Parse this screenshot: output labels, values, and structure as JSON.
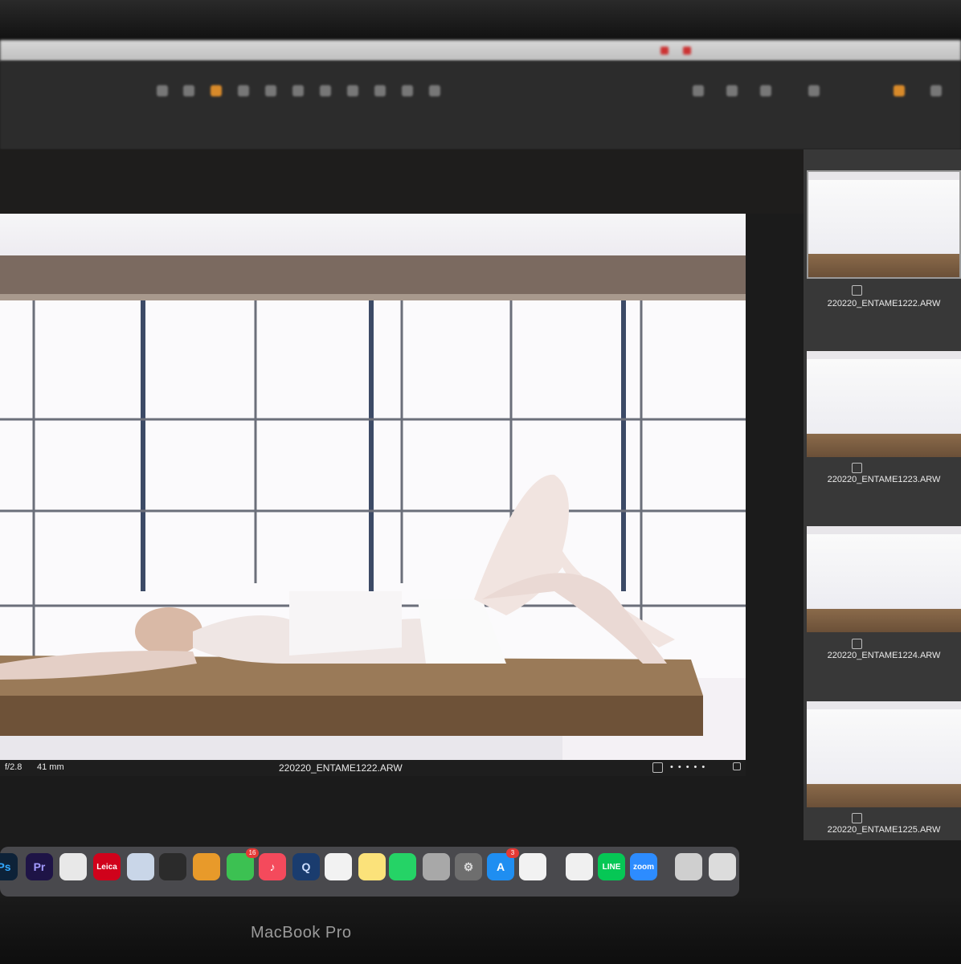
{
  "main_photo": {
    "filename": "220220_ENTAME1222.ARW",
    "aperture": "f/2.8",
    "focal_length": "41 mm"
  },
  "filmstrip": [
    {
      "filename": "220220_ENTAME1222.ARW"
    },
    {
      "filename": "220220_ENTAME1223.ARW"
    },
    {
      "filename": "220220_ENTAME1224.ARW"
    },
    {
      "filename": "220220_ENTAME1225.ARW"
    }
  ],
  "dock": {
    "apps": [
      {
        "name": "photoshop-icon",
        "label": "Ps",
        "color": "#0d2238",
        "fg": "#31a8ff"
      },
      {
        "name": "premiere-icon",
        "label": "Pr",
        "color": "#1e1446",
        "fg": "#a39bff"
      },
      {
        "name": "chrome-icon",
        "label": "",
        "color": "#e8e8e8",
        "fg": "#333"
      },
      {
        "name": "leica-icon",
        "label": "Leica",
        "color": "#d0021b",
        "fg": "#ffffff"
      },
      {
        "name": "preview-icon",
        "label": "",
        "color": "#c9d6e8",
        "fg": "#333"
      },
      {
        "name": "davinci-resolve-icon",
        "label": "",
        "color": "#2b2b2b",
        "fg": "#fff"
      },
      {
        "name": "pages-icon",
        "label": "",
        "color": "#e89a2a",
        "fg": "#fff"
      },
      {
        "name": "facetime-icon",
        "label": "",
        "color": "#3cc152",
        "fg": "#fff"
      },
      {
        "name": "music-icon",
        "label": "♪",
        "color": "#f44a5c",
        "fg": "#fff"
      },
      {
        "name": "quicktime-icon",
        "label": "Q",
        "color": "#1a3c6e",
        "fg": "#cfe0ff"
      },
      {
        "name": "script-editor-icon",
        "label": "",
        "color": "#f2f2f2",
        "fg": "#333"
      },
      {
        "name": "notes-icon",
        "label": "",
        "color": "#fbe27a",
        "fg": "#333"
      },
      {
        "name": "whatsapp-icon",
        "label": "",
        "color": "#25d366",
        "fg": "#fff"
      },
      {
        "name": "screenshot-icon",
        "label": "",
        "color": "#a8a8a8",
        "fg": "#333"
      },
      {
        "name": "system-preferences-icon",
        "label": "⚙",
        "color": "#6e6e6e",
        "fg": "#ddd"
      },
      {
        "name": "app-store-icon",
        "label": "A",
        "color": "#1f8ef1",
        "fg": "#fff"
      },
      {
        "name": "keynote-icon",
        "label": "",
        "color": "#f2f2f2",
        "fg": "#333"
      },
      {
        "name": "acrobat-icon",
        "label": "",
        "color": "#f0f0f0",
        "fg": "#e02020"
      },
      {
        "name": "line-icon",
        "label": "LINE",
        "color": "#06c755",
        "fg": "#fff"
      },
      {
        "name": "zoom-icon",
        "label": "zoom",
        "color": "#2d8cff",
        "fg": "#fff"
      },
      {
        "name": "downloads-icon",
        "label": "",
        "color": "#cfcfcf",
        "fg": "#333"
      },
      {
        "name": "trash-icon",
        "label": "",
        "color": "#dcdcdc",
        "fg": "#333"
      }
    ],
    "badges": {
      "facetime": "16",
      "app_store": "3"
    }
  },
  "laptop": {
    "brand": "MacBook Pro"
  }
}
